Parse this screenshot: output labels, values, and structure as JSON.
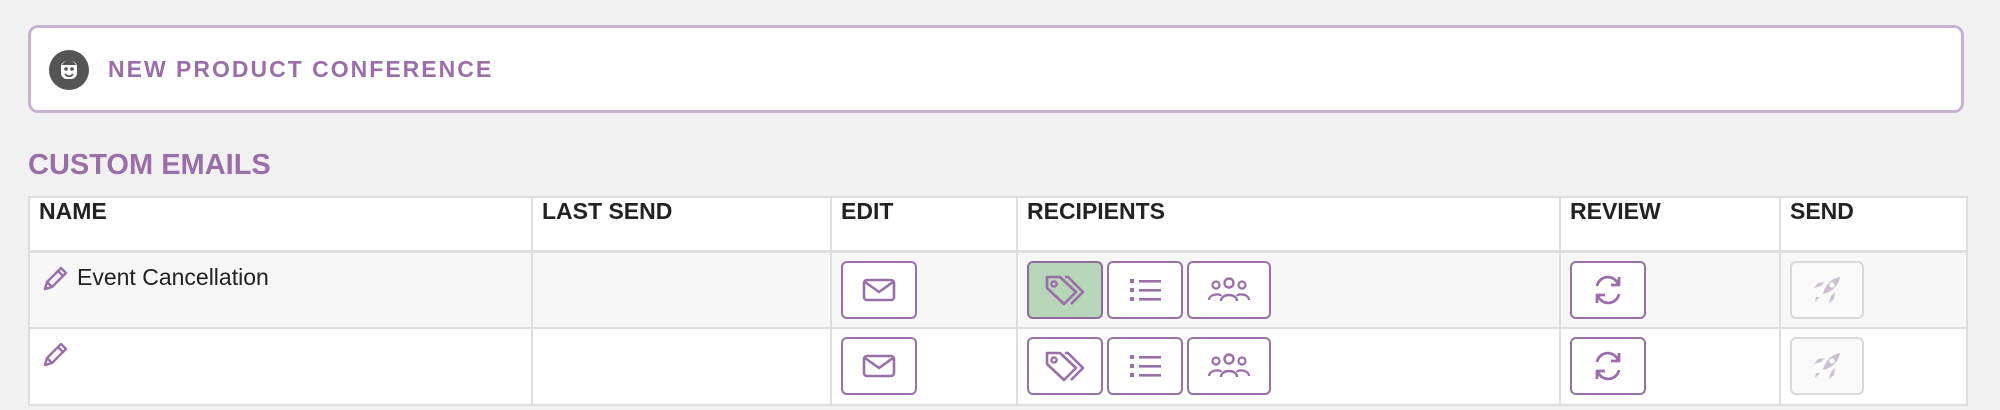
{
  "header": {
    "conference_title": "NEW PRODUCT CONFERENCE",
    "logo_icon": "mascot-face-icon"
  },
  "section": {
    "title": "CUSTOM EMAILS"
  },
  "table": {
    "columns": [
      "NAME",
      "LAST SEND",
      "EDIT",
      "RECIPIENTS",
      "REVIEW",
      "SEND"
    ],
    "rows": [
      {
        "name": "Event Cancellation",
        "last_send": "",
        "recipients_tags_selected": true,
        "send_enabled": false
      },
      {
        "name": "",
        "last_send": "",
        "recipients_tags_selected": false,
        "send_enabled": false
      }
    ]
  },
  "icons": {
    "edit_name": "pencil-icon",
    "edit": "envelope-icon",
    "recipients_tags": "tags-icon",
    "recipients_list": "list-icon",
    "recipients_groups": "users-icon",
    "review": "refresh-icon",
    "send": "rocket-icon"
  },
  "colors": {
    "accent": "#9a6fa8",
    "header_border": "#c6b2d3",
    "selected_bg": "#b7d6b9",
    "disabled": "#cbbfd0",
    "page_bg": "#f1f1f1"
  }
}
